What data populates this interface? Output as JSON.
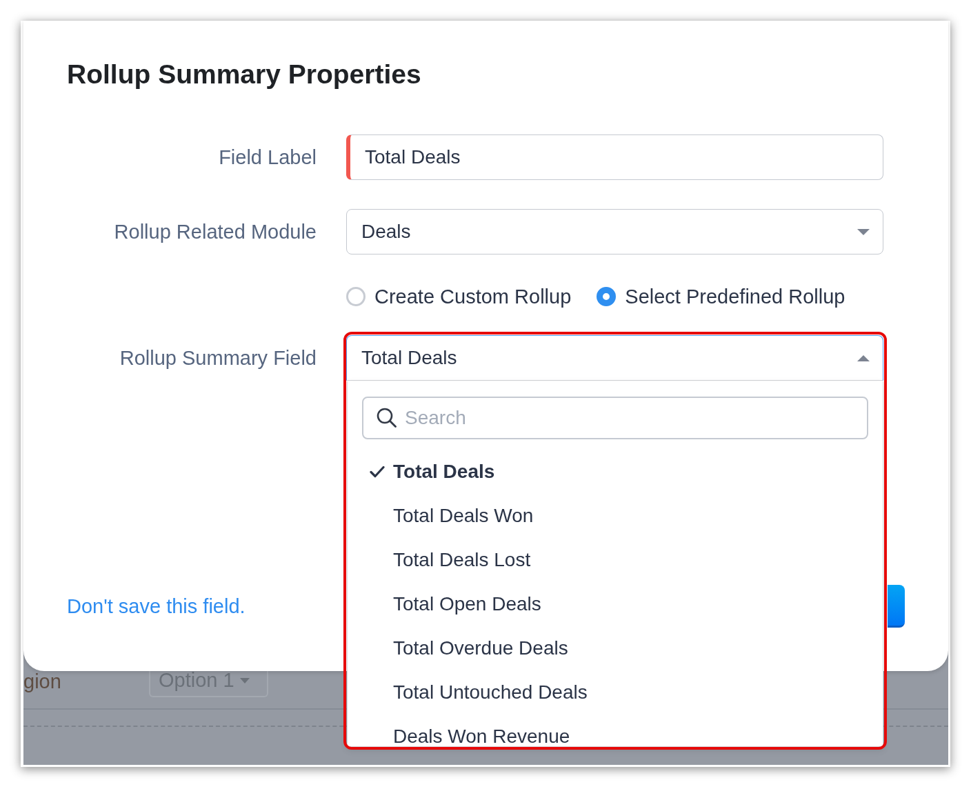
{
  "dialog": {
    "title": "Rollup Summary Properties",
    "fields": [
      {
        "kind": "text",
        "label": "Field Label",
        "value": "Total Deals",
        "required": true
      },
      {
        "kind": "select",
        "label": "Rollup Related Module",
        "value": "Deals",
        "expanded": false
      },
      {
        "kind": "radio_group",
        "options": [
          {
            "label": "Create Custom Rollup",
            "selected": false
          },
          {
            "label": "Select Predefined Rollup",
            "selected": true
          }
        ]
      },
      {
        "kind": "select",
        "label": "Rollup Summary Field",
        "value": "Total Deals",
        "expanded": true,
        "highlighted": true,
        "dropdown": {
          "search": {
            "placeholder": "Search"
          },
          "options": [
            {
              "label": "Total Deals",
              "selected": true
            },
            {
              "label": "Total Deals Won",
              "selected": false
            },
            {
              "label": "Total Deals Lost",
              "selected": false
            },
            {
              "label": "Total Open Deals",
              "selected": false
            },
            {
              "label": "Total Overdue Deals",
              "selected": false
            },
            {
              "label": "Total Untouched Deals",
              "selected": false
            },
            {
              "label": "Deals Won Revenue",
              "selected": false
            }
          ]
        }
      }
    ],
    "footer": {
      "link": "Don't save this field."
    }
  },
  "background": {
    "label": "gion",
    "select": {
      "value": "Option 1"
    }
  }
}
